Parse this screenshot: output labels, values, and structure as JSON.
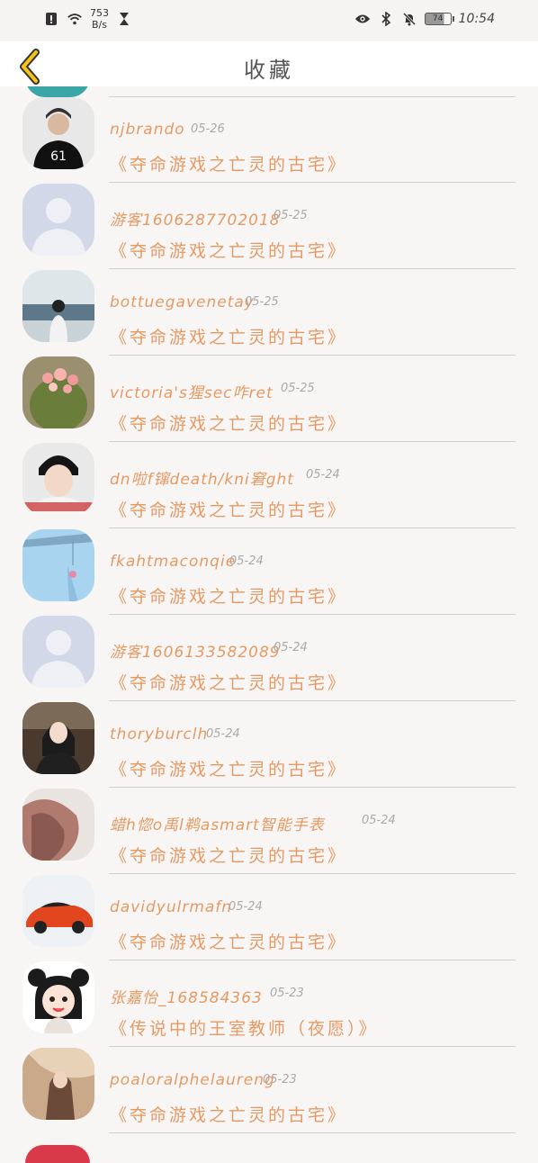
{
  "status_bar": {
    "net_speed_value": "753",
    "net_speed_unit": "B/s",
    "battery": "74",
    "time": "10:54"
  },
  "header": {
    "title": "收藏"
  },
  "items": [
    {
      "user": "njbrando",
      "date": "05-26",
      "book": "《夺命游戏之亡灵的古宅》",
      "avatar": "photo-girl-jersey-61"
    },
    {
      "user": "游客1606287702018",
      "date": "05-25",
      "book": "《夺命游戏之亡灵的古宅》",
      "avatar": "default-avatar"
    },
    {
      "user": "bottuegavenetay",
      "date": "05-25",
      "book": "《夺命游戏之亡灵的古宅》",
      "avatar": "photo-girl-sea"
    },
    {
      "user": "victoria's猩sec咋ret",
      "date": "05-25",
      "book": "《夺命游戏之亡灵的古宅》",
      "avatar": "photo-cactus"
    },
    {
      "user": "dn啦f镩death/kni窘ght",
      "date": "05-24",
      "book": "《夺命游戏之亡灵的古宅》",
      "avatar": "photo-boy-portrait"
    },
    {
      "user": "fkahtmaconqie",
      "date": "05-24",
      "book": "《夺命游戏之亡灵的古宅》",
      "avatar": "photo-sky-windchime"
    },
    {
      "user": "游客1606133582089",
      "date": "05-24",
      "book": "《夺命游戏之亡灵的古宅》",
      "avatar": "default-avatar"
    },
    {
      "user": "thoryburclh",
      "date": "05-24",
      "book": "《夺命游戏之亡灵的古宅》",
      "avatar": "photo-girl-chinese-text"
    },
    {
      "user": "蜡h惚o禹l鹈asmart智能手表",
      "date": "05-24",
      "book": "《夺命游戏之亡灵的古宅》",
      "avatar": "photo-red-hair"
    },
    {
      "user": "davidyulrmafn",
      "date": "05-24",
      "book": "《夺命游戏之亡灵的古宅》",
      "avatar": "photo-orange-car"
    },
    {
      "user": "张嘉怡_168584363",
      "date": "05-23",
      "book": "《传说中的王室教师（夜愿）》",
      "avatar": "cartoon-girl"
    },
    {
      "user": "poaloralphelaureng",
      "date": "05-23",
      "book": "《夺命游戏之亡灵的古宅》",
      "avatar": "photo-vintage-girl"
    }
  ]
}
